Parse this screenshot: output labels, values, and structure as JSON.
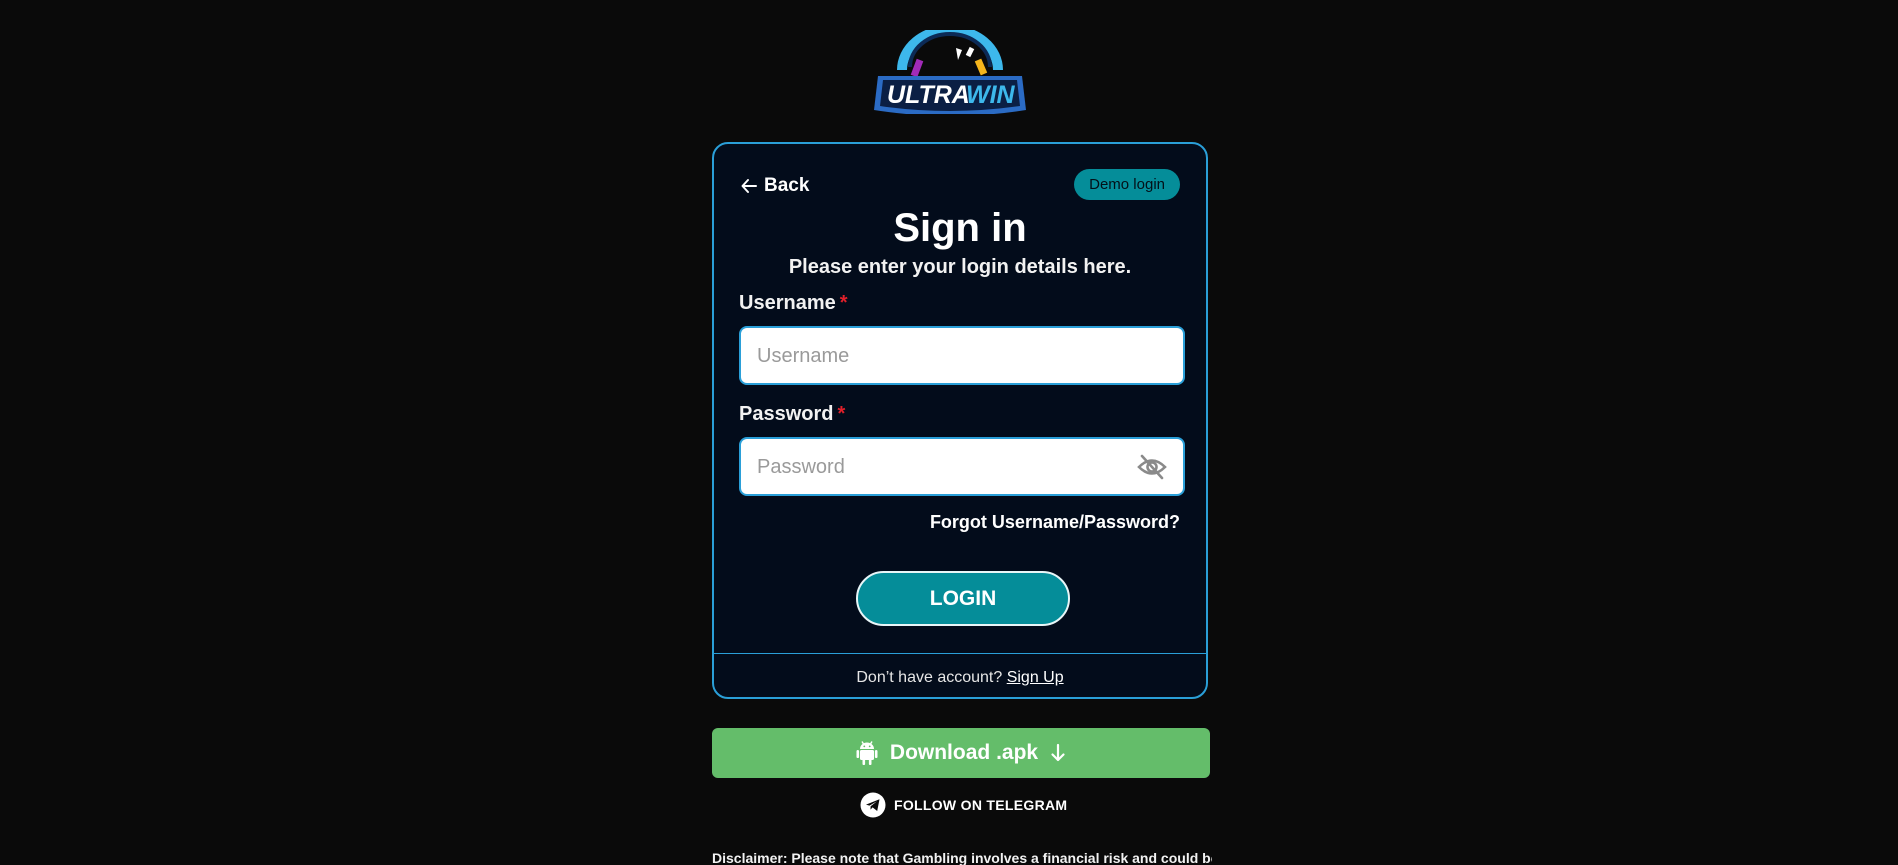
{
  "logo": {
    "text_part1": "ULTRA",
    "text_part2": "WIN"
  },
  "card": {
    "back_label": "Back",
    "demo_label": "Demo login",
    "title": "Sign in",
    "subtitle": "Please enter your login details here.",
    "username": {
      "label": "Username",
      "required_mark": "*",
      "value": "",
      "placeholder": "Username"
    },
    "password": {
      "label": "Password",
      "required_mark": "*",
      "value": "",
      "placeholder": "Password",
      "toggle_icon": "eye-off-icon"
    },
    "forgot_label": "Forgot Username/Password?",
    "login_label": "LOGIN",
    "no_account_text": "Don’t have account?",
    "signup_label": "Sign Up"
  },
  "download": {
    "label": "Download .apk",
    "icon": "android-icon"
  },
  "telegram": {
    "label": "FOLLOW ON TELEGRAM",
    "icon": "telegram-icon"
  },
  "disclaimer": "Disclaimer: Please note that Gambling involves a financial risk and could be",
  "colors": {
    "background": "#0a0a0a",
    "card_bg": "#030c1b",
    "card_border": "#2a9fd8",
    "accent_teal": "#058d99",
    "download_green": "#64bd6a",
    "required_red": "#e0202a"
  }
}
